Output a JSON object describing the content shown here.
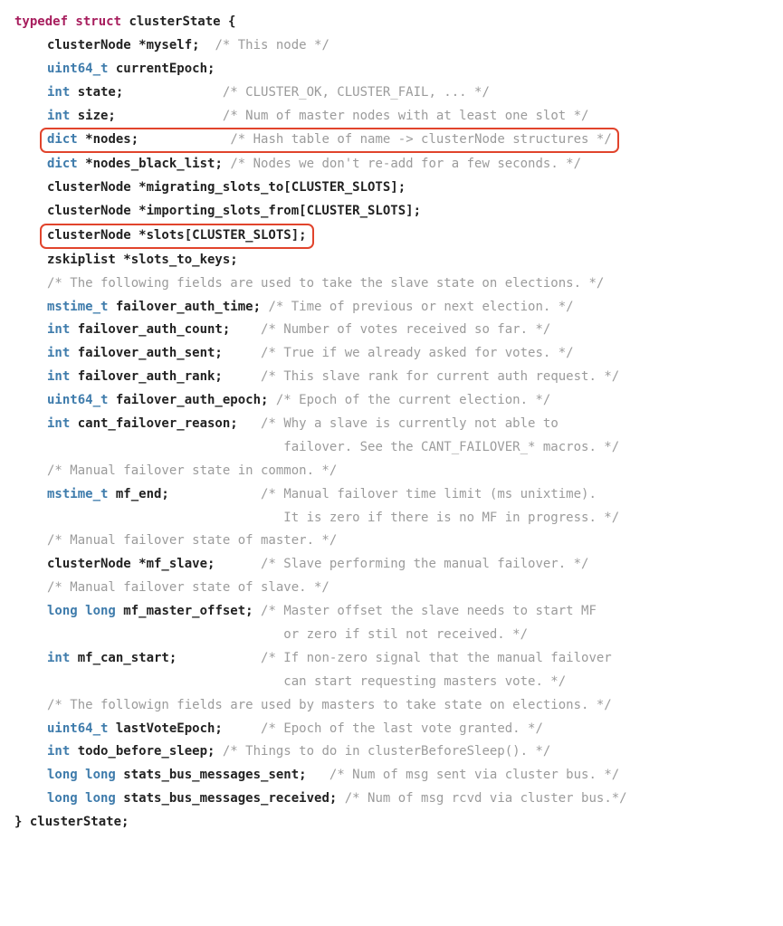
{
  "code": {
    "l1": {
      "kw": "typedef struct ",
      "name": "clusterState {"
    },
    "l2": {
      "code": "clusterNode *myself;",
      "comment": "/* This node */"
    },
    "l3": {
      "type": "uint64_t ",
      "name": "currentEpoch;"
    },
    "l4": {
      "type": "int ",
      "name": "state;",
      "comment": "/* CLUSTER_OK, CLUSTER_FAIL, ... */"
    },
    "l5": {
      "type": "int ",
      "name": "size;",
      "comment": "/* Num of master nodes with at least one slot */"
    },
    "l6": {
      "type": "dict ",
      "name": "*nodes;",
      "comment": "/* Hash table of name -> clusterNode structures */"
    },
    "l7": {
      "type": "dict ",
      "name": "*nodes_black_list;",
      "comment": "/* Nodes we don't re-add for a few seconds. */"
    },
    "l8": {
      "code": "clusterNode *migrating_slots_to[CLUSTER_SLOTS];"
    },
    "l9": {
      "code": "clusterNode *importing_slots_from[CLUSTER_SLOTS];"
    },
    "l10": {
      "code": "clusterNode *slots[CLUSTER_SLOTS];"
    },
    "l11": {
      "code": "zskiplist *slots_to_keys;"
    },
    "l12": {
      "comment": "/* The following fields are used to take the slave state on elections. */"
    },
    "l13": {
      "type": "mstime_t ",
      "name": "failover_auth_time;",
      "comment": "/* Time of previous or next election. */"
    },
    "l14": {
      "type": "int ",
      "name": "failover_auth_count;",
      "comment": "/* Number of votes received so far. */"
    },
    "l15": {
      "type": "int ",
      "name": "failover_auth_sent;",
      "comment": "/* True if we already asked for votes. */"
    },
    "l16": {
      "type": "int ",
      "name": "failover_auth_rank;",
      "comment": "/* This slave rank for current auth request. */"
    },
    "l17": {
      "type": "uint64_t ",
      "name": "failover_auth_epoch;",
      "comment": "/* Epoch of the current election. */"
    },
    "l18": {
      "type": "int ",
      "name": "cant_failover_reason;",
      "comment": "/* Why a slave is currently not able to"
    },
    "l18b": {
      "comment": "failover. See the CANT_FAILOVER_* macros. */"
    },
    "l19": {
      "comment": "/* Manual failover state in common. */"
    },
    "l20": {
      "type": "mstime_t ",
      "name": "mf_end;",
      "comment": "/* Manual failover time limit (ms unixtime)."
    },
    "l20b": {
      "comment": "It is zero if there is no MF in progress. */"
    },
    "l21": {
      "comment": "/* Manual failover state of master. */"
    },
    "l22": {
      "code": "clusterNode *mf_slave;",
      "comment": "/* Slave performing the manual failover. */"
    },
    "l23": {
      "comment": "/* Manual failover state of slave. */"
    },
    "l24": {
      "type": "long long ",
      "name": "mf_master_offset;",
      "comment": "/* Master offset the slave needs to start MF"
    },
    "l24b": {
      "comment": "or zero if stil not received. */"
    },
    "l25": {
      "type": "int ",
      "name": "mf_can_start;",
      "comment": "/* If non-zero signal that the manual failover"
    },
    "l25b": {
      "comment": "can start requesting masters vote. */"
    },
    "l26": {
      "comment": "/* The followign fields are used by masters to take state on elections. */"
    },
    "l27": {
      "type": "uint64_t ",
      "name": "lastVoteEpoch;",
      "comment": "/* Epoch of the last vote granted. */"
    },
    "l28": {
      "type": "int ",
      "name": "todo_before_sleep;",
      "comment": "/* Things to do in clusterBeforeSleep(). */"
    },
    "l29": {
      "type": "long long ",
      "name": "stats_bus_messages_sent;",
      "comment": "/* Num of msg sent via cluster bus. */"
    },
    "l30": {
      "type": "long long ",
      "name": "stats_bus_messages_received;",
      "comment": "/* Num of msg rcvd via cluster bus.*/"
    },
    "l31": {
      "code": "} clusterState;"
    }
  }
}
